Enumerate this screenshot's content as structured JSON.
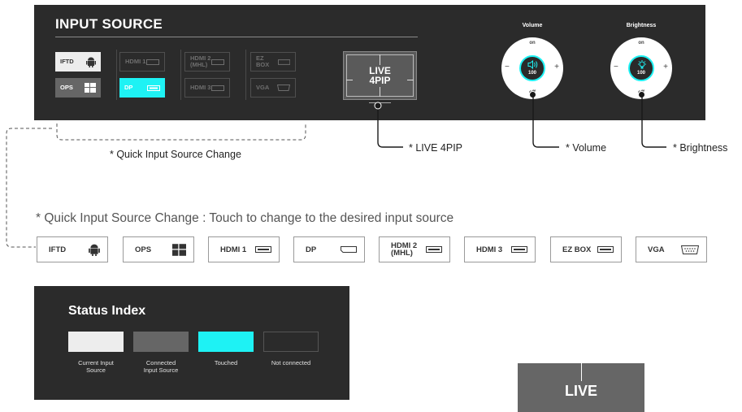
{
  "panel": {
    "title": "INPUT SOURCE",
    "sources": [
      {
        "label": "IFTD",
        "state": "current",
        "icon": "android-icon"
      },
      {
        "label": "HDMI 1",
        "state": "notconn",
        "icon": "hdmi-port-icon"
      },
      {
        "label": "HDMI 2\n(MHL)",
        "state": "notconn",
        "icon": "hdmi-port-icon"
      },
      {
        "label": "EZ BOX",
        "state": "notconn",
        "icon": "hdmi-port-icon"
      },
      {
        "label": "OPS",
        "state": "connected",
        "icon": "windows-icon"
      },
      {
        "label": "DP",
        "state": "touched",
        "icon": "displayport-icon"
      },
      {
        "label": "HDMI 3",
        "state": "notconn",
        "icon": "hdmi-port-icon"
      },
      {
        "label": "VGA",
        "state": "notconn",
        "icon": "vga-port-icon"
      }
    ],
    "live_line1": "LIVE",
    "live_line2": "4PIP",
    "volume": {
      "label": "Volume",
      "on": "on",
      "off": "off",
      "minus": "−",
      "plus": "+",
      "value": "100"
    },
    "brightness": {
      "label": "Brightness",
      "on": "on",
      "off": "off",
      "minus": "−",
      "plus": "+",
      "value": "100"
    }
  },
  "callouts": {
    "quick": "* Quick Input Source Change",
    "live": "* LIVE 4PIP",
    "volume": "* Volume",
    "brightness": "* Brightness"
  },
  "note": "* Quick Input Source Change : Touch to change to the desired input source",
  "buttons": [
    {
      "label": "IFTD",
      "icon": "android-icon"
    },
    {
      "label": "OPS",
      "icon": "windows-icon"
    },
    {
      "label": "HDMI 1",
      "icon": "hdmi-port-icon"
    },
    {
      "label": "DP",
      "icon": "displayport-icon"
    },
    {
      "label": "HDMI 2\n(MHL)",
      "icon": "hdmi-port-icon"
    },
    {
      "label": "HDMI 3",
      "icon": "hdmi-port-icon"
    },
    {
      "label": "EZ BOX",
      "icon": "hdmi-port-icon"
    },
    {
      "label": "VGA",
      "icon": "vga-port-icon"
    }
  ],
  "status": {
    "title": "Status Index",
    "items": [
      {
        "label": "Current Input\nSource",
        "color": "#ededed"
      },
      {
        "label": "Connected\nInput Source",
        "color": "#666666"
      },
      {
        "label": "Touched",
        "color": "#1ef2f4"
      },
      {
        "label": "Not connected",
        "color": "#2b2b2b"
      }
    ]
  },
  "bottom_live": "LIVE",
  "colors": {
    "panel": "#2b2b2b",
    "accent": "#1ef2f4"
  }
}
